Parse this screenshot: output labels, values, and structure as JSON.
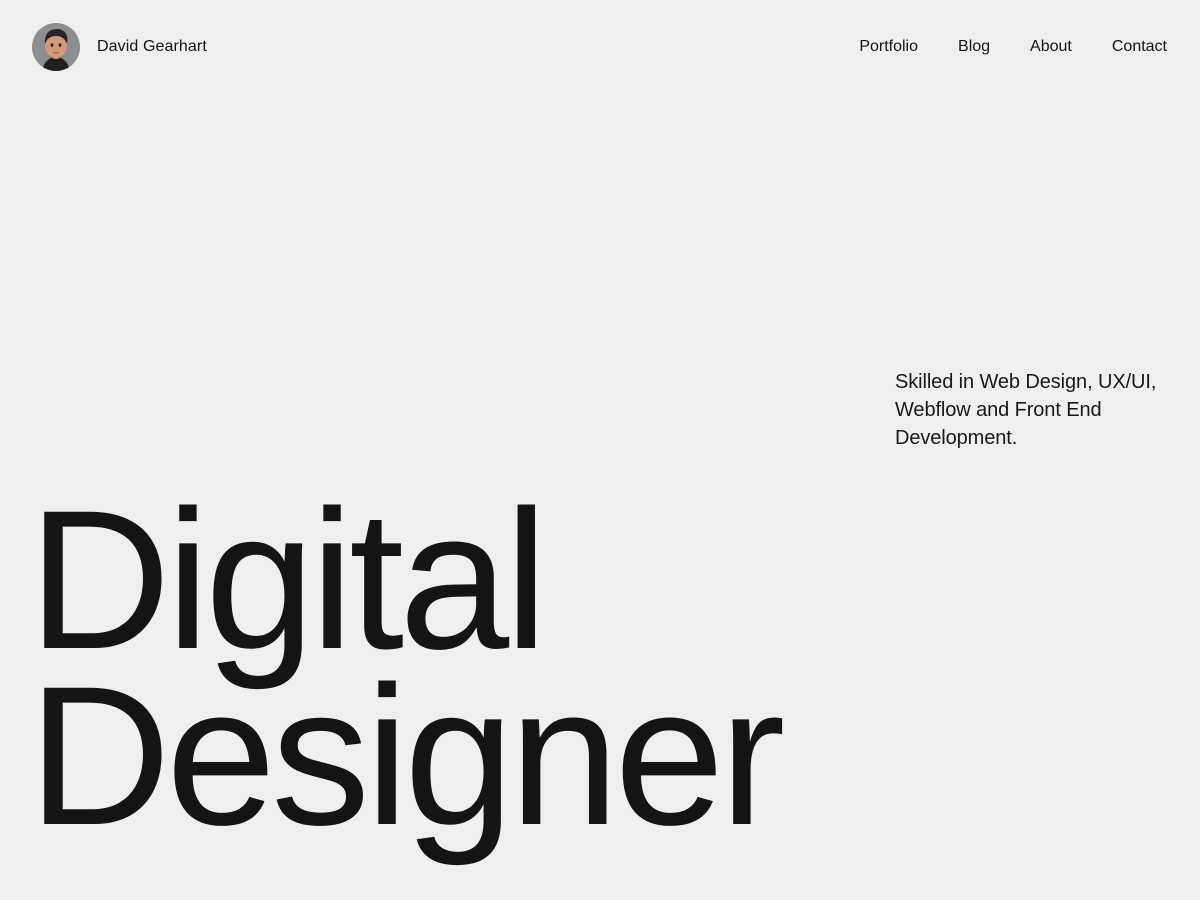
{
  "header": {
    "brand_name": "David Gearhart",
    "nav": [
      {
        "label": "Portfolio"
      },
      {
        "label": "Blog"
      },
      {
        "label": "About"
      },
      {
        "label": "Contact"
      }
    ]
  },
  "hero": {
    "tagline": "Skilled in Web Design, UX/UI, Webflow and Front End Development.",
    "title_line_1": "Digital",
    "title_line_2": "Designer"
  },
  "colors": {
    "background": "#efefef",
    "text": "#141414"
  }
}
